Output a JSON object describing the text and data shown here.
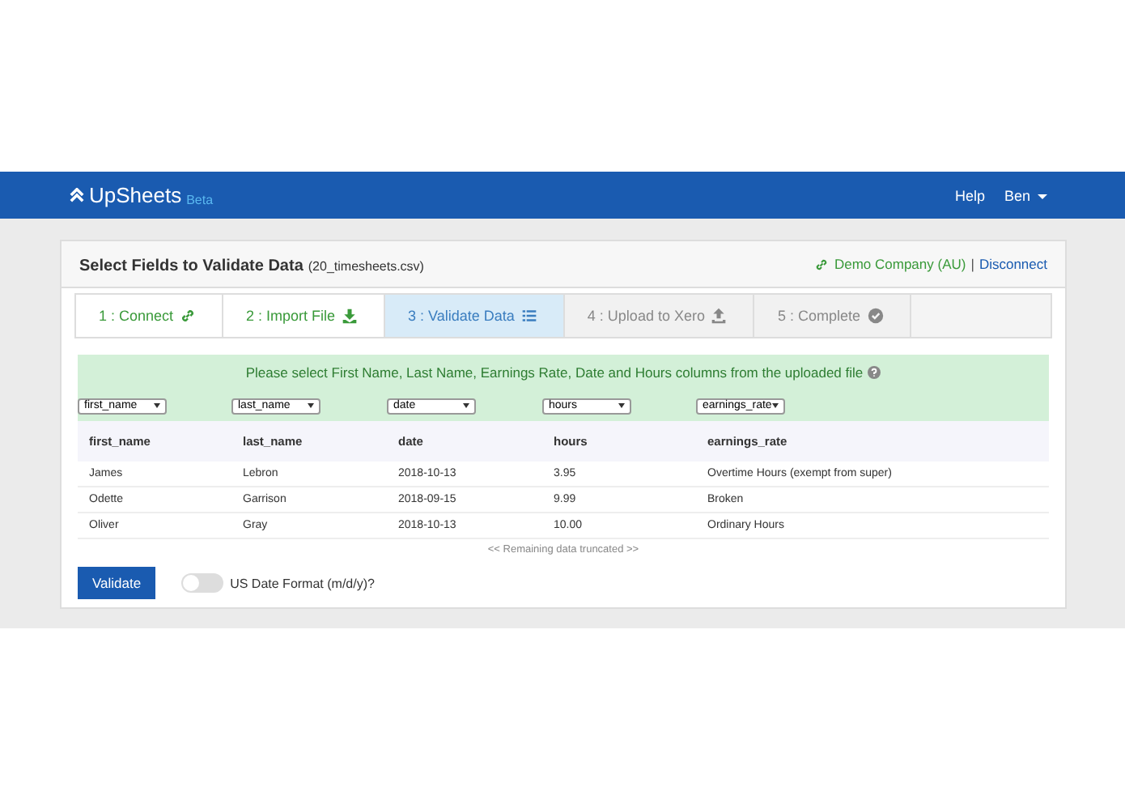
{
  "navbar": {
    "brand": "UpSheets",
    "badge": "Beta",
    "links": [
      "Help",
      "Ben"
    ]
  },
  "card": {
    "title": "Select Fields to Validate Data",
    "file": "(20_timesheets.csv)",
    "company": "Demo Company (AU)",
    "separator": "|",
    "disconnect": "Disconnect"
  },
  "steps": [
    {
      "label": "1 : Connect",
      "completed": true,
      "selected": false
    },
    {
      "label": "2 : Import File",
      "completed": true,
      "selected": false
    },
    {
      "label": "3 : Validate Data",
      "completed": false,
      "selected": true
    },
    {
      "label": "4 : Upload to Xero",
      "completed": false,
      "selected": false
    },
    {
      "label": "5 : Complete",
      "completed": false,
      "selected": false
    }
  ],
  "instruction": "Please select First Name, Last Name, Earnings Rate, Date and Hours columns from the uploaded file",
  "selects": [
    "first_name",
    "last_name",
    "date",
    "hours",
    "earnings_rate"
  ],
  "table": {
    "columns": [
      "first_name",
      "last_name",
      "date",
      "hours",
      "earnings_rate"
    ],
    "rows": [
      [
        "James",
        "Lebron",
        "2018-10-13",
        "3.95",
        "Overtime Hours (exempt from super)"
      ],
      [
        "Odette",
        "Garrison",
        "2018-09-15",
        "9.99",
        "Broken"
      ],
      [
        "Oliver",
        "Gray",
        "2018-10-13",
        "10.00",
        "Ordinary Hours"
      ]
    ]
  },
  "truncated": "<< Remaining data truncated >>",
  "validate_button": "Validate",
  "us_date": {
    "label": "US Date Format (m/d/y)?",
    "on": false
  }
}
